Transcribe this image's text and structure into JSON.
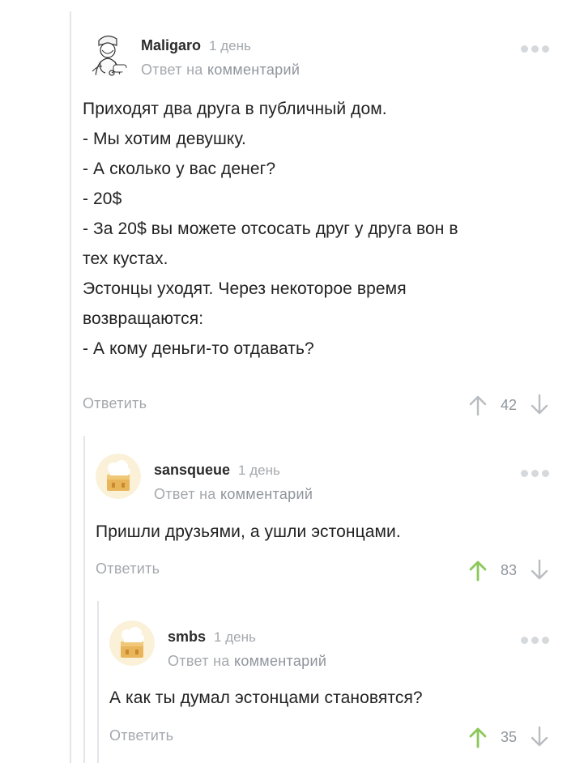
{
  "comments": [
    {
      "author": "Maligaro",
      "time": "1 день",
      "reply_prefix": "Ответ на",
      "reply_link": "комментарий",
      "lines": [
        "Приходят два друга в публичный дом.",
        "- Мы хотим девушку.",
        "- А сколько у вас денег?",
        "- 20$",
        "- За 20$ вы можете отсосать друг у друга вон в",
        "тех кустах.",
        "Эстонцы уходят. Через некоторое время",
        "возвращаются:",
        "- А кому деньги-то отдавать?"
      ],
      "reply_label": "Ответить",
      "rating": "42",
      "upvoted": false
    },
    {
      "author": "sansqueue",
      "time": "1 день",
      "reply_prefix": "Ответ на",
      "reply_link": "комментарий",
      "lines": [
        "Пришли друзьями, а ушли эстонцами."
      ],
      "reply_label": "Ответить",
      "rating": "83",
      "upvoted": true
    },
    {
      "author": "smbs",
      "time": "1 день",
      "reply_prefix": "Ответ на",
      "reply_link": "комментарий",
      "lines": [
        "А как ты думал эстонцами становятся?"
      ],
      "reply_label": "Ответить",
      "rating": "35",
      "upvoted": true
    }
  ],
  "colors": {
    "upvote_active": "#8ac858",
    "arrow_inactive": "#b9bdc1",
    "thread_line": "#e3e5e8",
    "meta_text": "#a4a8ad"
  },
  "icons": {
    "upvote": "arrow-up-icon",
    "downvote": "arrow-down-icon",
    "more": "more-dots-icon",
    "avatar_default": "chef-hat-avatar"
  }
}
